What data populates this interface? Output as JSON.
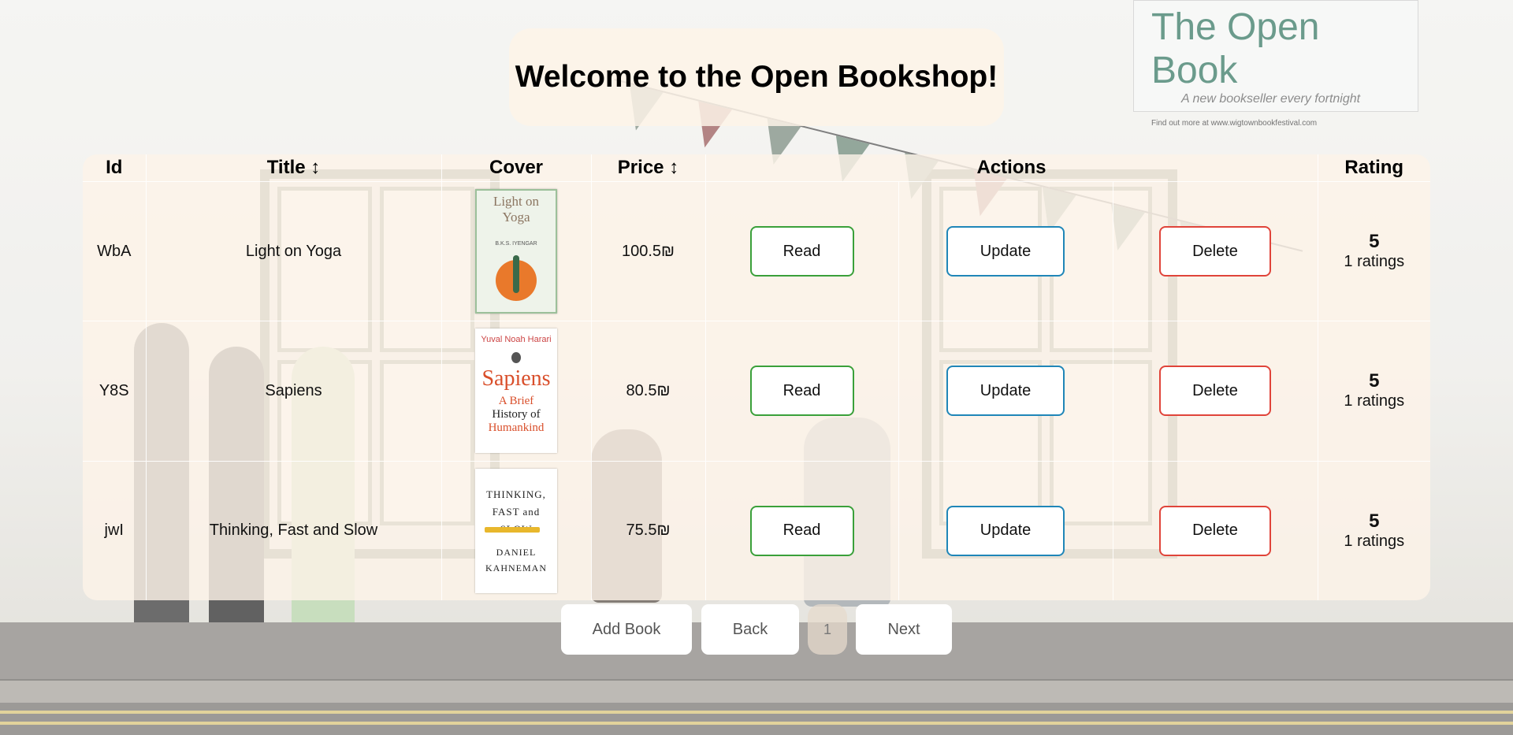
{
  "header": {
    "title": "Welcome to the Open Bookshop!"
  },
  "table": {
    "columns": {
      "id": "Id",
      "title": "Title",
      "cover": "Cover",
      "price": "Price",
      "actions": "Actions",
      "rating": "Rating",
      "sort_icon": "↕"
    },
    "rows": [
      {
        "id": "WbA",
        "title": "Light on Yoga",
        "price": "100.5₪",
        "read_label": "Read",
        "update_label": "Update",
        "delete_label": "Delete",
        "rating": "5",
        "rating_count": "1 ratings",
        "cover": {
          "title_l1": "Light on",
          "title_l2": "Yoga",
          "author": "B.K.S. IYENGAR",
          "icon": "yoga-figure-sun"
        }
      },
      {
        "id": "Y8S",
        "title": "Sapiens",
        "price": "80.5₪",
        "read_label": "Read",
        "update_label": "Update",
        "delete_label": "Delete",
        "rating": "5",
        "rating_count": "1 ratings",
        "cover": {
          "author": "Yuval Noah Harari",
          "title": "Sapiens",
          "sub_l1": "A Brief",
          "sub_l2": "History of",
          "sub_l3": "Humankind"
        }
      },
      {
        "id": "jwI",
        "title": "Thinking, Fast and Slow",
        "price": "75.5₪",
        "read_label": "Read",
        "update_label": "Update",
        "delete_label": "Delete",
        "rating": "5",
        "rating_count": "1 ratings",
        "cover": {
          "title_l1": "THINKING,",
          "title_l2": "FAST and SLOW",
          "author_l1": "DANIEL",
          "author_l2": "KAHNEMAN",
          "icon": "pencil"
        }
      }
    ]
  },
  "pager": {
    "add_label": "Add Book",
    "back_label": "Back",
    "page": "1",
    "next_label": "Next"
  },
  "background": {
    "sign_title": "The Open Book",
    "sign_tagline": "A new bookseller every fortnight",
    "sign_footer": "Find out more at www.wigtownbookfestival.com"
  },
  "colors": {
    "read_border": "#3aa03a",
    "update_border": "#1f86b8",
    "delete_border": "#e0443a",
    "panel_bg": "#fdf3e8"
  }
}
